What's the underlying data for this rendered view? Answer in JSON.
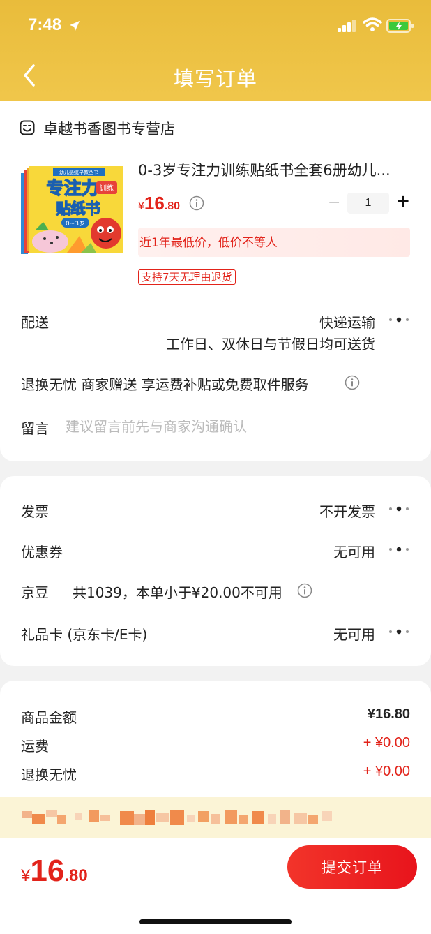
{
  "status_bar": {
    "time": "7:48"
  },
  "nav": {
    "title": "填写订单"
  },
  "store": {
    "name": "卓越书香图书专营店"
  },
  "product": {
    "title": "0-3岁专注力训练贴纸书全套6册幼儿...",
    "price_symbol": "¥",
    "price_int": "16",
    "price_dec": ".80",
    "quantity": "1",
    "minus_label": "−",
    "plus_label": "+",
    "lowest_price_note": "近1年最低价，低价不等人",
    "return_tag": "支持7天无理由退货",
    "cover_text": {
      "series": "幼儿感统早教丛书",
      "title_main": "专注力",
      "title_tag": "训练",
      "title_sub": "贴纸书",
      "age": "0~3岁"
    }
  },
  "delivery": {
    "label": "配送",
    "method": "快递运输",
    "time_note": "工作日、双休日与节假日均可送货"
  },
  "return_service": {
    "text": "退换无忧 商家赠送 享运费补贴或免费取件服务"
  },
  "message": {
    "label": "留言",
    "placeholder": "建议留言前先与商家沟通确认"
  },
  "invoice": {
    "label": "发票",
    "value": "不开发票"
  },
  "coupon": {
    "label": "优惠券",
    "value": "无可用"
  },
  "jd_beans": {
    "label": "京豆",
    "detail": "共1039，本单小于¥20.00不可用"
  },
  "gift_card": {
    "label": "礼品卡 (京东卡/E卡)",
    "value": "无可用"
  },
  "summary": {
    "goods_label": "商品金额",
    "goods_value": "¥16.80",
    "shipping_label": "运费",
    "shipping_value": "+ ¥0.00",
    "return_label": "退换无忧",
    "return_value": "+ ¥0.00"
  },
  "bottom": {
    "price_symbol": "¥",
    "price_int": "16",
    "price_dec": ".80",
    "submit_label": "提交订单"
  },
  "colors": {
    "accent": "#e2231a",
    "header": "#f1c84d",
    "notice_bg": "#fbf4d6"
  },
  "icons": [
    "location-arrow-icon",
    "signal-icon",
    "wifi-icon",
    "battery-charging-icon",
    "back-icon",
    "store-icon",
    "info-icon",
    "more-dots-icon"
  ]
}
